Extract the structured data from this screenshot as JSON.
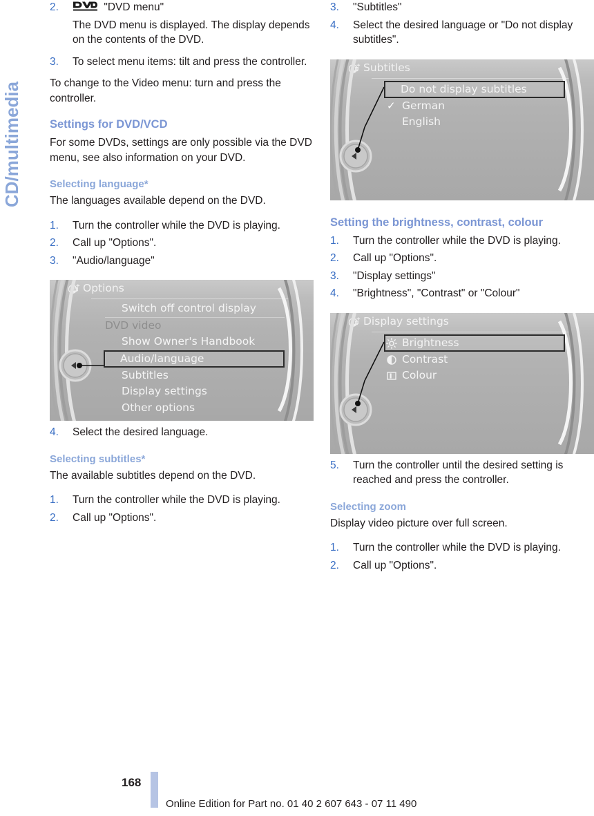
{
  "side_tab": {
    "label": "CD/multimedia"
  },
  "left_column": {
    "step2": {
      "num": "2.",
      "icon": "dvd-logo-icon",
      "text": "\"DVD menu\""
    },
    "step2_detail": "The DVD menu is displayed. The display depends on the contents of the DVD.",
    "step3": {
      "num": "3.",
      "text": "To select menu items: tilt and press the controller."
    },
    "video_menu_note": "To change to the Video menu: turn and press the controller.",
    "heading_settings": "Settings for DVD/VCD",
    "settings_intro": "For some DVDs, settings are only possible via the DVD menu, see also information on your DVD.",
    "heading_language": "Selecting language*",
    "language_intro": "The languages available depend on the DVD.",
    "language_steps": [
      {
        "num": "1.",
        "text": "Turn the controller while the DVD is playing."
      },
      {
        "num": "2.",
        "text": "Call up \"Options\"."
      },
      {
        "num": "3.",
        "text": "\"Audio/language\""
      }
    ],
    "options_screen": {
      "title": "Options",
      "icon": "cd-music-icon",
      "items": [
        {
          "label": "Switch off control display",
          "style": "indent-sep"
        },
        {
          "label": "DVD video",
          "style": "dim"
        },
        {
          "label": "Show Owner's Handbook",
          "style": "indent"
        },
        {
          "label": "Audio/language",
          "style": "selected"
        },
        {
          "label": "Subtitles",
          "style": "indent"
        },
        {
          "label": "Display settings",
          "style": "indent"
        },
        {
          "label": "Other options",
          "style": "indent"
        }
      ]
    },
    "language_step4": {
      "num": "4.",
      "text": "Select the desired language."
    },
    "heading_subtitles": "Selecting subtitles*",
    "subtitles_intro": "The available subtitles depend on the DVD.",
    "subtitles_steps": [
      {
        "num": "1.",
        "text": "Turn the controller while the DVD is playing."
      },
      {
        "num": "2.",
        "text": "Call up \"Options\"."
      }
    ]
  },
  "right_column": {
    "subtitles_steps_cont": [
      {
        "num": "3.",
        "text": "\"Subtitles\""
      },
      {
        "num": "4.",
        "text": "Select the desired language or \"Do not display subtitles\"."
      }
    ],
    "subtitles_screen": {
      "title": "Subtitles",
      "icon": "cd-music-icon",
      "items": [
        {
          "label": "Do not display subtitles",
          "style": "selected"
        },
        {
          "label": "German",
          "style": "checked"
        },
        {
          "label": "English",
          "style": "indent"
        }
      ]
    },
    "heading_brightness": "Setting the brightness, contrast, colour",
    "brightness_steps": [
      {
        "num": "1.",
        "text": "Turn the controller while the DVD is playing."
      },
      {
        "num": "2.",
        "text": "Call up \"Options\"."
      },
      {
        "num": "3.",
        "text": "\"Display settings\""
      },
      {
        "num": "4.",
        "text": "\"Brightness\", \"Contrast\" or \"Colour\""
      }
    ],
    "display_screen": {
      "title": "Display settings",
      "icon": "cd-music-icon",
      "items": [
        {
          "label": "Brightness",
          "style": "selected",
          "icon": "sun-icon"
        },
        {
          "label": "Contrast",
          "style": "icon",
          "icon": "contrast-icon"
        },
        {
          "label": "Colour",
          "style": "icon",
          "icon": "colour-icon"
        }
      ]
    },
    "brightness_step5": {
      "num": "5.",
      "text": "Turn the controller until the desired setting is reached and press the controller."
    },
    "heading_zoom": "Selecting zoom",
    "zoom_intro": "Display video picture over full screen.",
    "zoom_steps": [
      {
        "num": "1.",
        "text": "Turn the controller while the DVD is playing."
      },
      {
        "num": "2.",
        "text": "Call up \"Options\"."
      }
    ]
  },
  "footer": {
    "page_number": "168",
    "edition_text": "Online Edition for Part no. 01 40 2 607 643 - 07 11 490"
  },
  "colors": {
    "heading_blue": "#7b96d4",
    "subheading_blue": "#8ba7d9",
    "number_blue": "#3a6fc4",
    "tab_blue": "#8ba7d9",
    "footer_bar": "#b6c4e4"
  }
}
